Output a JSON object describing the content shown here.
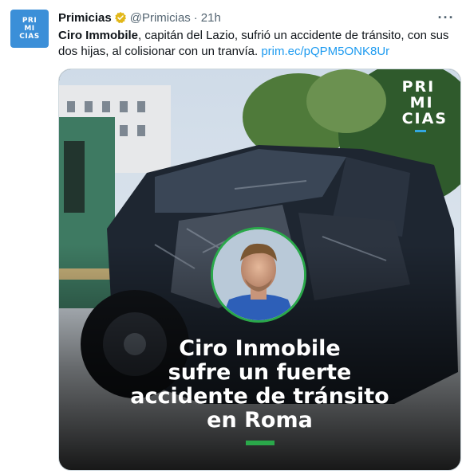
{
  "tweet": {
    "author_name": "Primicias",
    "handle": "@Primicias",
    "separator": "·",
    "time": "21h",
    "more_label": "···",
    "avatar_lines": [
      "PRI",
      "MI",
      "CIAS"
    ],
    "text_bold": "Ciro Immobile",
    "text_body": ", capitán del Lazio, sufrió un accidente de tránsito, con sus dos hijas, al colisionar con un tranvía. ",
    "link": "prim.ec/pQPM5ONK8Ur"
  },
  "media": {
    "logo_lines": [
      "PRI",
      "MI",
      "CIAS"
    ],
    "headline_lines": [
      "Ciro Inmobile",
      "sufre un fuerte",
      "accidente de tránsito",
      "en Roma"
    ],
    "accent_color": "#2aa84a",
    "brand_color": "#3b8fd8"
  }
}
